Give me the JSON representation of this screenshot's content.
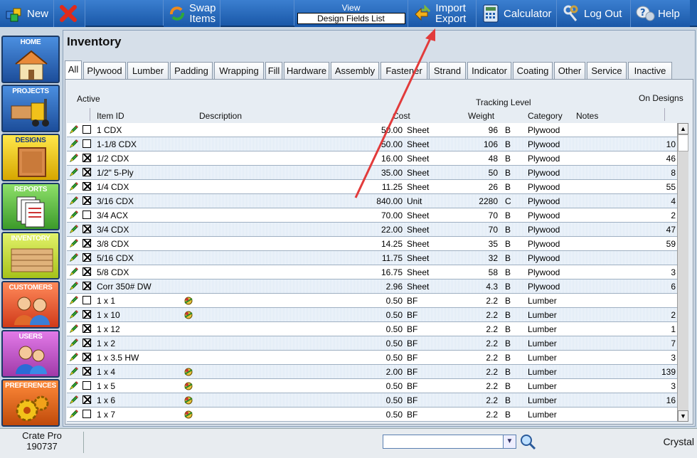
{
  "toolbar": {
    "new": "New",
    "swap_1": "Swap",
    "swap_2": "Items",
    "view_label": "View",
    "view_value": "Design Fields List",
    "import_1": "Import",
    "import_2": "Export",
    "calculator": "Calculator",
    "logout": "Log Out",
    "help": "Help"
  },
  "nav": [
    "HOME",
    "PROJECTS",
    "DESIGNS",
    "REPORTS",
    "INVENTORY",
    "CUSTOMERS",
    "USERS",
    "PREFERENCES"
  ],
  "page_title": "Inventory",
  "tabs": [
    "All",
    "Plywood",
    "Lumber",
    "Padding",
    "Wrapping",
    "Fill",
    "Hardware",
    "Assembly",
    "Fastener",
    "Strand",
    "Indicator",
    "Coating",
    "Other",
    "Service",
    "Inactive"
  ],
  "headers": {
    "active": "Active",
    "item_id": "Item ID",
    "description": "Description",
    "cost": "Cost",
    "tracking": "Tracking Level",
    "weight": "Weight",
    "category": "Category",
    "notes": "Notes",
    "on_designs": "On Designs"
  },
  "rows": [
    {
      "checked": false,
      "id": "1 CDX",
      "icon": false,
      "cost": "50.00",
      "unit": "Sheet",
      "weight": "96",
      "wunit": "B",
      "cat": "Plywood",
      "des": ""
    },
    {
      "checked": false,
      "id": "1-1/8 CDX",
      "icon": false,
      "cost": "50.00",
      "unit": "Sheet",
      "weight": "106",
      "wunit": "B",
      "cat": "Plywood",
      "des": "10"
    },
    {
      "checked": true,
      "id": "1/2 CDX",
      "icon": false,
      "cost": "16.00",
      "unit": "Sheet",
      "weight": "48",
      "wunit": "B",
      "cat": "Plywood",
      "des": "46"
    },
    {
      "checked": true,
      "id": "1/2\" 5-Ply",
      "icon": false,
      "cost": "35.00",
      "unit": "Sheet",
      "weight": "50",
      "wunit": "B",
      "cat": "Plywood",
      "des": "8"
    },
    {
      "checked": true,
      "id": "1/4 CDX",
      "icon": false,
      "cost": "11.25",
      "unit": "Sheet",
      "weight": "26",
      "wunit": "B",
      "cat": "Plywood",
      "des": "55"
    },
    {
      "checked": true,
      "id": "3/16 CDX",
      "icon": false,
      "cost": "840.00",
      "unit": "Unit",
      "weight": "2280",
      "wunit": "C",
      "cat": "Plywood",
      "des": "4"
    },
    {
      "checked": false,
      "id": "3/4 ACX",
      "icon": false,
      "cost": "70.00",
      "unit": "Sheet",
      "weight": "70",
      "wunit": "B",
      "cat": "Plywood",
      "des": "2"
    },
    {
      "checked": true,
      "id": "3/4 CDX",
      "icon": false,
      "cost": "22.00",
      "unit": "Sheet",
      "weight": "70",
      "wunit": "B",
      "cat": "Plywood",
      "des": "47"
    },
    {
      "checked": true,
      "id": "3/8 CDX",
      "icon": false,
      "cost": "14.25",
      "unit": "Sheet",
      "weight": "35",
      "wunit": "B",
      "cat": "Plywood",
      "des": "59"
    },
    {
      "checked": true,
      "id": "5/16 CDX",
      "icon": false,
      "cost": "11.75",
      "unit": "Sheet",
      "weight": "32",
      "wunit": "B",
      "cat": "Plywood",
      "des": ""
    },
    {
      "checked": true,
      "id": "5/8 CDX",
      "icon": false,
      "cost": "16.75",
      "unit": "Sheet",
      "weight": "58",
      "wunit": "B",
      "cat": "Plywood",
      "des": "3"
    },
    {
      "checked": true,
      "id": "Corr 350# DW",
      "icon": false,
      "cost": "2.96",
      "unit": "Sheet",
      "weight": "4.3",
      "wunit": "B",
      "cat": "Plywood",
      "des": "6"
    },
    {
      "checked": false,
      "id": "1 x 1",
      "icon": true,
      "cost": "0.50",
      "unit": "BF",
      "weight": "2.2",
      "wunit": "B",
      "cat": "Lumber",
      "des": ""
    },
    {
      "checked": true,
      "id": "1 x 10",
      "icon": true,
      "cost": "0.50",
      "unit": "BF",
      "weight": "2.2",
      "wunit": "B",
      "cat": "Lumber",
      "des": "2"
    },
    {
      "checked": true,
      "id": "1 x 12",
      "icon": false,
      "cost": "0.50",
      "unit": "BF",
      "weight": "2.2",
      "wunit": "B",
      "cat": "Lumber",
      "des": "1"
    },
    {
      "checked": true,
      "id": "1 x 2",
      "icon": false,
      "cost": "0.50",
      "unit": "BF",
      "weight": "2.2",
      "wunit": "B",
      "cat": "Lumber",
      "des": "7"
    },
    {
      "checked": true,
      "id": "1 x 3.5 HW",
      "icon": false,
      "cost": "0.50",
      "unit": "BF",
      "weight": "2.2",
      "wunit": "B",
      "cat": "Lumber",
      "des": "3"
    },
    {
      "checked": true,
      "id": "1 x 4",
      "icon": true,
      "cost": "2.00",
      "unit": "BF",
      "weight": "2.2",
      "wunit": "B",
      "cat": "Lumber",
      "des": "139"
    },
    {
      "checked": false,
      "id": "1 x 5",
      "icon": true,
      "cost": "0.50",
      "unit": "BF",
      "weight": "2.2",
      "wunit": "B",
      "cat": "Lumber",
      "des": "3"
    },
    {
      "checked": true,
      "id": "1 x 6",
      "icon": true,
      "cost": "0.50",
      "unit": "BF",
      "weight": "2.2",
      "wunit": "B",
      "cat": "Lumber",
      "des": "16"
    },
    {
      "checked": false,
      "id": "1 x 7",
      "icon": true,
      "cost": "0.50",
      "unit": "BF",
      "weight": "2.2",
      "wunit": "B",
      "cat": "Lumber",
      "des": ""
    }
  ],
  "status": {
    "app": "Crate Pro",
    "version": "190737",
    "user": "Crystal"
  },
  "colors": {
    "toolbar": "#1f5fae",
    "annotation_arrow": "#e23b3b"
  }
}
